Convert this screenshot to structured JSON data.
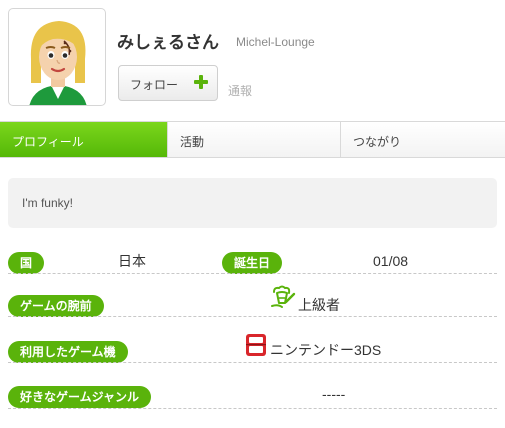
{
  "profile": {
    "display_name": "みしぇるさん",
    "user_id": "Michel-Lounge",
    "follow_label": "フォロー",
    "report_label": "通報",
    "bio": "I'm funky!"
  },
  "tabs": [
    {
      "label": "プロフィール",
      "active": true
    },
    {
      "label": "活動",
      "active": false
    },
    {
      "label": "つながり",
      "active": false
    }
  ],
  "details": {
    "country_label": "国",
    "country_value": "日本",
    "birthday_label": "誕生日",
    "birthday_value": "01/08",
    "skill_label": "ゲームの腕前",
    "skill_value": "上級者",
    "skill_icon": "expert-badge-icon",
    "systems_label": "利用したゲーム機",
    "systems_value": "ニンテンドー3DS",
    "systems_icon": "nintendo-3ds-icon",
    "genre_label": "好きなゲームジャンル",
    "genre_value": "-----"
  },
  "colors": {
    "accent": "#5ab30b",
    "tab_active": "#6cc914",
    "console_red": "#d9262b"
  }
}
